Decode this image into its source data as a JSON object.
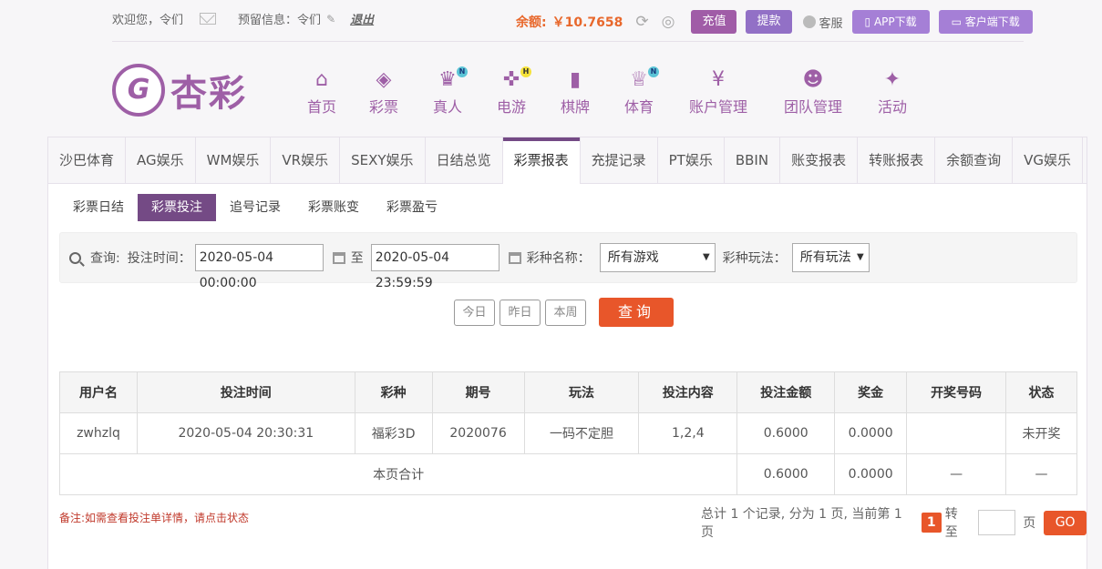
{
  "topbar": {
    "welcome": "欢迎您，",
    "username": "令们",
    "reserve_label": "预留信息：",
    "reserve_value": "令们",
    "logout": "退出",
    "balance_label": "余额:",
    "balance_value": "￥10.7658",
    "recharge": "充值",
    "withdraw": "提款",
    "service": "客服",
    "app_download": "APP下载",
    "client_download": "客户端下载"
  },
  "logo": {
    "text": "杏彩"
  },
  "nav": [
    {
      "label": "首页",
      "icon": "home-icon",
      "badge": ""
    },
    {
      "label": "彩票",
      "icon": "ticket-icon",
      "badge": ""
    },
    {
      "label": "真人",
      "icon": "dealer-icon",
      "badge": "N"
    },
    {
      "label": "电游",
      "icon": "gamepad-icon",
      "badge": "H"
    },
    {
      "label": "棋牌",
      "icon": "cards-icon",
      "badge": ""
    },
    {
      "label": "体育",
      "icon": "trophy-icon",
      "badge": "N"
    },
    {
      "label": "账户管理",
      "icon": "yen-icon",
      "badge": ""
    },
    {
      "label": "团队管理",
      "icon": "team-icon",
      "badge": ""
    },
    {
      "label": "活动",
      "icon": "gift-icon",
      "badge": ""
    }
  ],
  "tabs": [
    "沙巴体育",
    "AG娱乐",
    "WM娱乐",
    "VR娱乐",
    "SEXY娱乐",
    "日结总览",
    "彩票报表",
    "充提记录",
    "PT娱乐",
    "BBIN",
    "账变报表",
    "转账报表",
    "余额查询",
    "VG娱乐"
  ],
  "active_tab": "彩票报表",
  "subtabs": [
    "彩票日结",
    "彩票投注",
    "追号记录",
    "彩票账变",
    "彩票盈亏"
  ],
  "active_subtab": "彩票投注",
  "query": {
    "label": "查询:",
    "time_label": "投注时间：",
    "start": "2020-05-04 00:00:00",
    "to": "至",
    "end": "2020-05-04 23:59:59",
    "game_label": "彩种名称：",
    "game_value": "所有游戏",
    "play_label": "彩种玩法：",
    "play_value": "所有玩法"
  },
  "quick": {
    "today": "今日",
    "yesterday": "昨日",
    "week": "本周",
    "query": "查询"
  },
  "table": {
    "headers": [
      "用户名",
      "投注时间",
      "彩种",
      "期号",
      "玩法",
      "投注内容",
      "投注金额",
      "奖金",
      "开奖号码",
      "状态"
    ],
    "rows": [
      [
        "zwhzlq",
        "2020-05-04 20:30:31",
        "福彩3D",
        "2020076",
        "一码不定胆",
        "1,2,4",
        "0.6000",
        "0.0000",
        "",
        "未开奖"
      ]
    ],
    "total": {
      "label": "本页合计",
      "amount": "0.6000",
      "bonus": "0.0000",
      "draw": "—",
      "status": "—"
    }
  },
  "note": "备注:如需查看投注单详情，请点击状态",
  "pager": {
    "summary": "总计 1 个记录, 分为 1 页, 当前第 1 页",
    "current": "1",
    "goto": "转至",
    "page_unit": "页",
    "go": "GO"
  },
  "colors": {
    "brand": "#9e5fa6",
    "accent": "#e8562a",
    "balance": "#e8682c"
  }
}
